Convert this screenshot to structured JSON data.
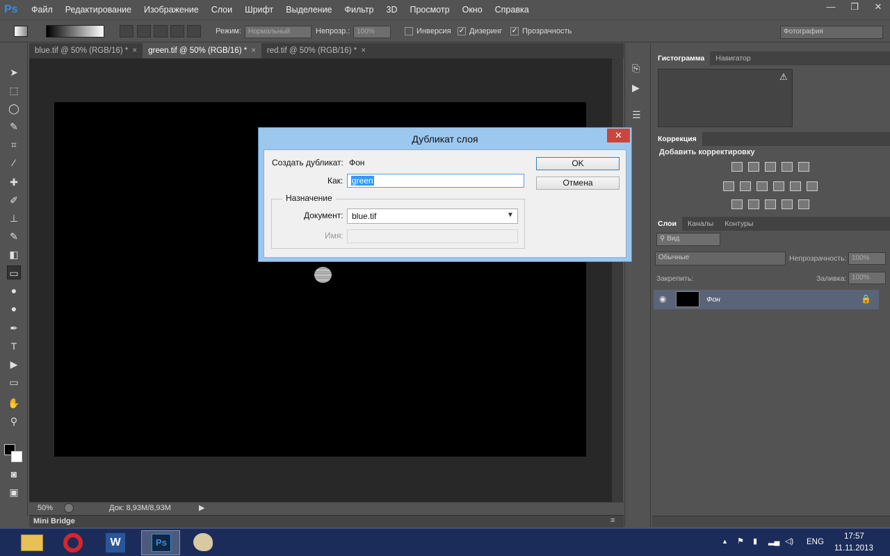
{
  "app": {
    "logo": "Ps"
  },
  "menu": [
    "Файл",
    "Редактирование",
    "Изображение",
    "Слои",
    "Шрифт",
    "Выделение",
    "Фильтр",
    "3D",
    "Просмотр",
    "Окно",
    "Справка"
  ],
  "window_controls": {
    "minimize": "—",
    "restore": "❐",
    "close": "✕"
  },
  "options": {
    "mode_label": "Режим:",
    "mode_value": "Нормальный",
    "opacity_label": "Непрозр.:",
    "opacity_value": "100%",
    "inverse_label": "Инверсия",
    "dither_label": "Дизеринг",
    "transparency_label": "Прозрачность",
    "workspace": "Фотография"
  },
  "tabs": [
    {
      "label": "blue.tif @ 50% (RGB/16) *",
      "close": "×"
    },
    {
      "label": "green.tif @ 50% (RGB/16) *",
      "close": "×"
    },
    {
      "label": "red.tif @ 50% (RGB/16) *",
      "close": "×"
    }
  ],
  "status": {
    "zoom": "50%",
    "doc": "Док: 8,93M/8,93M"
  },
  "minibridge": "Mini Bridge",
  "panels": {
    "histogram_tab": "Гистограмма",
    "navigator_tab": "Навигатор",
    "warning": "⚠",
    "correction_tab": "Коррекция",
    "add_adjustment": "Добавить корректировку",
    "layers_tab": "Слои",
    "channels_tab": "Каналы",
    "paths_tab": "Контуры",
    "filter_kind": "Вид",
    "blend_mode": "Обычные",
    "opacity_label": "Непрозрачность:",
    "opacity_value": "100%",
    "lock_label": "Закрепить:",
    "fill_label": "Заливка:",
    "fill_value": "100%",
    "layer_name": "Фон"
  },
  "dialog": {
    "title": "Дубликат слоя",
    "close": "✕",
    "source_label": "Создать дубликат:",
    "source_value": "Фон",
    "as_label": "Как:",
    "as_value": "green",
    "group_label": "Назначение",
    "document_label": "Документ:",
    "document_value": "blue.tif",
    "name_label": "Имя:",
    "ok": "OK",
    "cancel": "Отмена"
  },
  "taskbar": {
    "lang": "ENG",
    "time": "17:57",
    "date": "11.11.2013"
  },
  "colors": {
    "accent": "#3399ff",
    "dialog_frame": "#9cc8f0",
    "taskbar": "#1c2c5a"
  }
}
